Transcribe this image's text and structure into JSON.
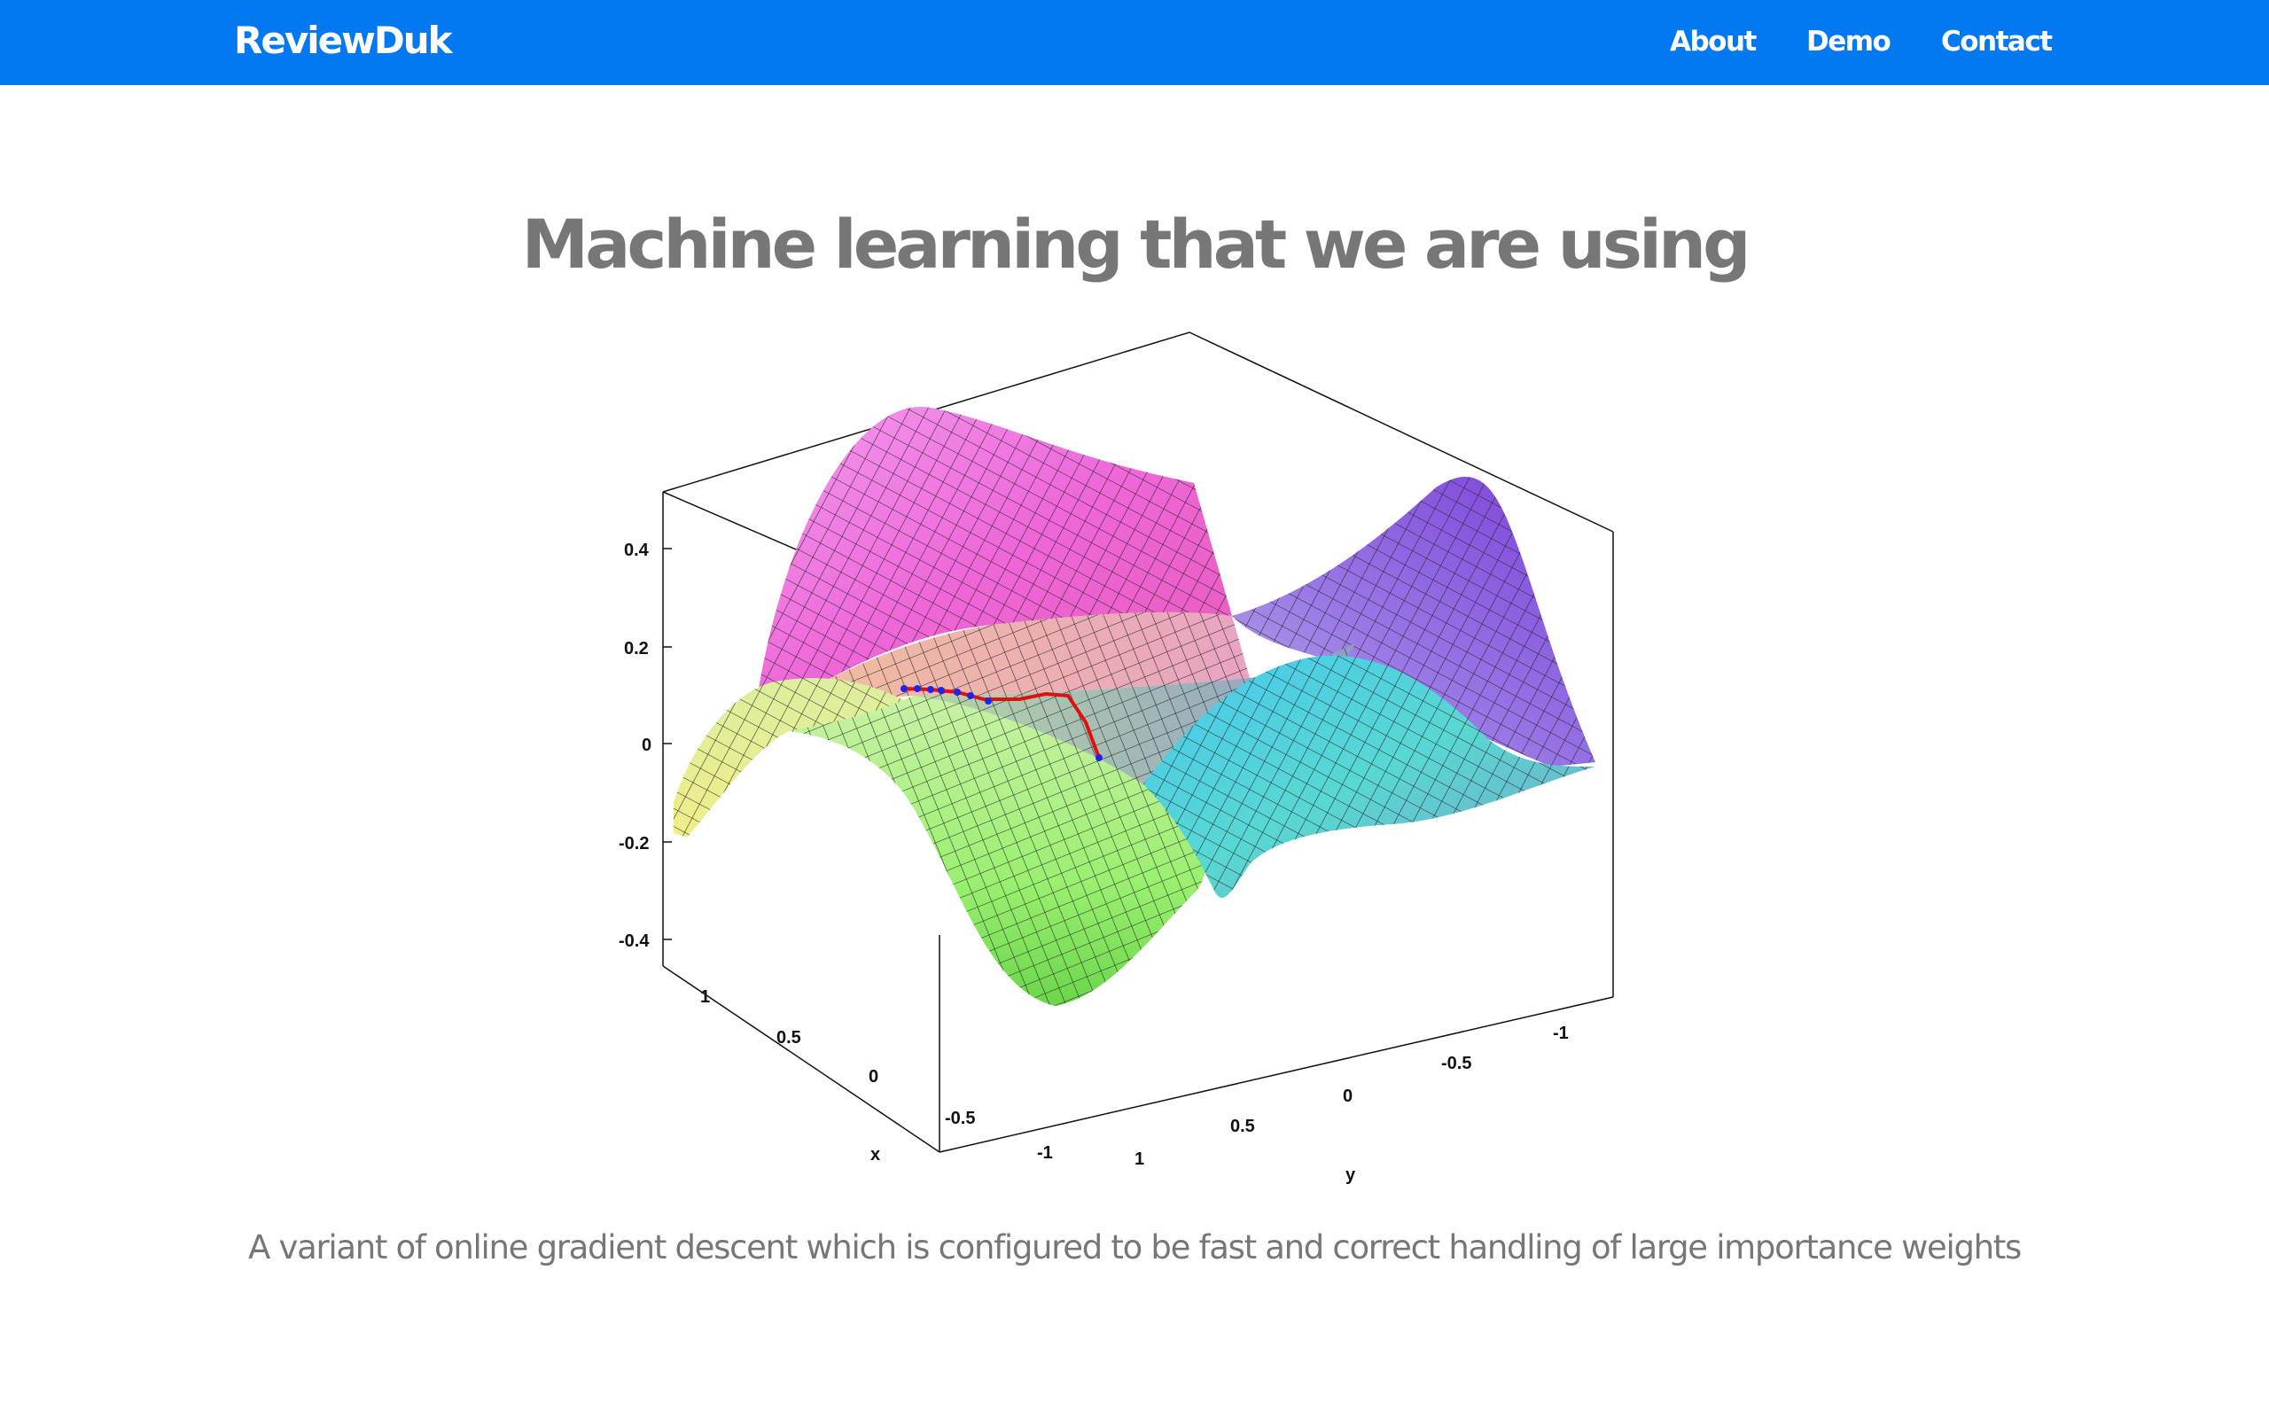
{
  "navbar": {
    "brand": "ReviewDuk",
    "links": [
      "About",
      "Demo",
      "Contact"
    ]
  },
  "main": {
    "title": "Machine learning that we are using",
    "caption": "A variant of online gradient descent which is configured to be fast and correct handling of large importance weights"
  },
  "figure": {
    "type": "3d-surface-plot",
    "z_ticks": [
      "0.4",
      "0.2",
      "0",
      "-0.2",
      "-0.4"
    ],
    "x_ticks": [
      "1",
      "0.5",
      "0",
      "-0.5",
      "-1"
    ],
    "y_ticks": [
      "1",
      "0.5",
      "0",
      "-0.5",
      "-1"
    ],
    "x_label": "x",
    "y_label": "y",
    "path_color": "#e01010",
    "path_point_color": "#2222ee"
  },
  "colors": {
    "navbar": "#0279f0",
    "nav_text": "#ffffff",
    "title_text": "#777777",
    "caption_text": "#777777"
  }
}
